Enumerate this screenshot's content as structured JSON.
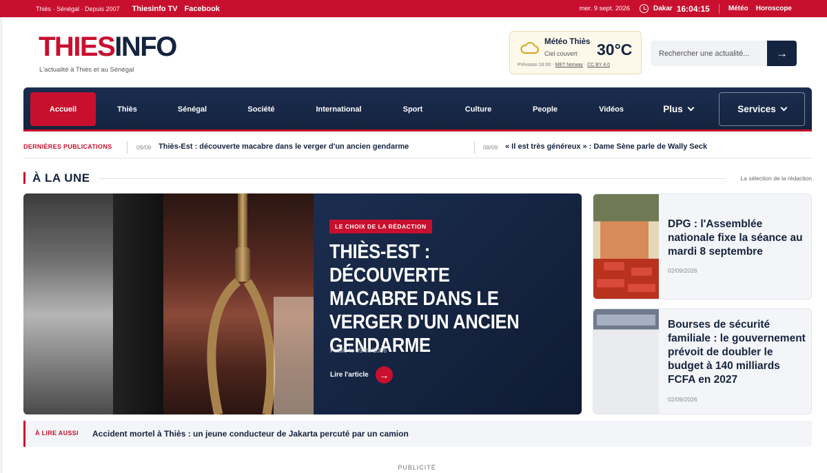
{
  "topbar": {
    "tagline": "Thiès · Sénégal · Depuis 2007",
    "links": [
      "Thiesinfo TV",
      "Facebook"
    ],
    "date": "mer. 9 sept. 2026",
    "city": "Dakar",
    "time": "16:04:15",
    "right_links": [
      "Météo",
      "Horoscope"
    ]
  },
  "brand": {
    "logo_red": "THIES",
    "logo_navy": "INFO",
    "slogan": "L'actualité à Thiès et au Sénégal",
    "colors": {
      "red": "#c8102e",
      "navy": "#14233f"
    }
  },
  "weather": {
    "title": "Météo Thiès",
    "condition": "Ciel couvert",
    "temperature": "30°C",
    "forecast_prefix": "Prévision 16:00 ·",
    "source": "MET Norway",
    "dot": "·",
    "license": "CC BY 4.0",
    "icon": "cloud-icon"
  },
  "search": {
    "placeholder": "Rechercher une actualité...",
    "button_icon": "→"
  },
  "nav": {
    "items": [
      "Accueil",
      "Thiès",
      "Sénégal",
      "Société",
      "International",
      "Sport",
      "Culture",
      "People",
      "Vidéos"
    ],
    "more": "Plus",
    "services": "Services",
    "active": "Accueil"
  },
  "latest": {
    "label": "DERNIÈRES PUBLICATIONS",
    "items": [
      {
        "date": "09/09",
        "title": "Thiès-Est : découverte macabre dans le verger d'un ancien gendarme"
      },
      {
        "date": "08/09",
        "title": "« Il est très généreux » : Dame Sène parle de Wally Seck"
      }
    ]
  },
  "section": {
    "title": "À LA UNE",
    "right": "La sélection de la rédaction"
  },
  "hero": {
    "badge": "LE CHOIX DE LA RÉDACTION",
    "title": "Thiès-Est : découverte macabre dans le verger d'un ancien gendarme",
    "published": "Publié le 09/09/2026",
    "read_more": "Lire l'article",
    "arrow": "→"
  },
  "side_articles": [
    {
      "title": "DPG : l'Assemblée nationale fixe la séance au mardi 8 septembre",
      "date": "02/09/2026"
    },
    {
      "title": "Bourses de sécurité familiale : le gouvernement prévoit de doubler le budget à 140 milliards FCFA en 2027",
      "date": "02/09/2026"
    }
  ],
  "also_read": {
    "label": "À LIRE AUSSI",
    "title": "Accident mortel à Thiès : un jeune conducteur de Jakarta percuté par un camion"
  },
  "ad_label": "PUBLICITÉ"
}
